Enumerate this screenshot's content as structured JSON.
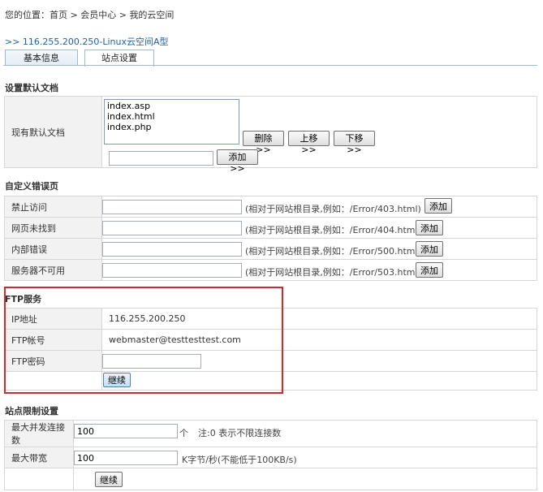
{
  "breadcrumb": {
    "prefix": "您的位置：",
    "items": [
      "首页",
      "会员中心",
      "我的云空间"
    ],
    "sep": " > "
  },
  "server_title": ">> 116.255.200.250-Linux云空间A型",
  "tabs": [
    {
      "label": "基本信息"
    },
    {
      "label": "站点设置"
    }
  ],
  "default_doc": {
    "title": "设置默认文档",
    "label": "现有默认文档",
    "items": [
      "index.asp",
      "index.html",
      "index.php"
    ],
    "delete_label": "删除>>",
    "up_label": "上移>>",
    "down_label": "下移>>",
    "new_value": "",
    "add_label": "添加>>"
  },
  "error_pages": {
    "title": "自定义错误页",
    "add_label": "添加",
    "rows": [
      {
        "label": "禁止访问",
        "value": "",
        "hint": "(相对于网站根目录,例如：/Error/403.html)"
      },
      {
        "label": "网页未找到",
        "value": "",
        "hint": "(相对于网站根目录,例如：/Error/404.html)"
      },
      {
        "label": "内部错误",
        "value": "",
        "hint": "(相对于网站根目录,例如：/Error/500.html)"
      },
      {
        "label": "服务器不可用",
        "value": "",
        "hint": "(相对于网站根目录,例如：/Error/503.html)"
      }
    ]
  },
  "ftp": {
    "title": "FTP服务",
    "ip_label": "IP地址",
    "ip_value": "116.255.200.250",
    "account_label": "FTP帐号",
    "account_value": "webmaster@testtesttest.com",
    "password_label": "FTP密码",
    "password_value": "",
    "continue_label": "继续"
  },
  "limits": {
    "title": "站点限制设置",
    "max_conn_label": "最大并发连接数",
    "max_conn_value": "100",
    "max_conn_unit": "个",
    "max_conn_hint": "注:0 表示不限连接数",
    "bandwidth_label": "最大带宽",
    "bandwidth_value": "100",
    "bandwidth_hint": "K字节/秒(不能低于100KB/s)",
    "continue_label": "继续"
  },
  "colors": {
    "link": "#1f5fa8",
    "highlight_border": "#d9262b",
    "label_bg": "#f2f2f2"
  }
}
